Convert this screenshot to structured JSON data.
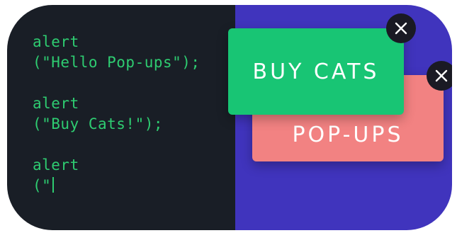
{
  "code": {
    "line1": "alert",
    "line2": "(\"Hello Pop-ups\");",
    "line3": "alert",
    "line4": "(\"Buy Cats!\");",
    "line5": "alert",
    "line6": "(\""
  },
  "popups": {
    "front": {
      "text": "BUY CATS",
      "close_icon": "close-icon",
      "color": "#18c574"
    },
    "back": {
      "text": "POP-UPS",
      "close_icon": "close-icon",
      "color": "#f28282"
    }
  },
  "colors": {
    "code_bg": "#191e26",
    "code_text": "#2ecc71",
    "popup_panel_bg": "#4034bd"
  }
}
